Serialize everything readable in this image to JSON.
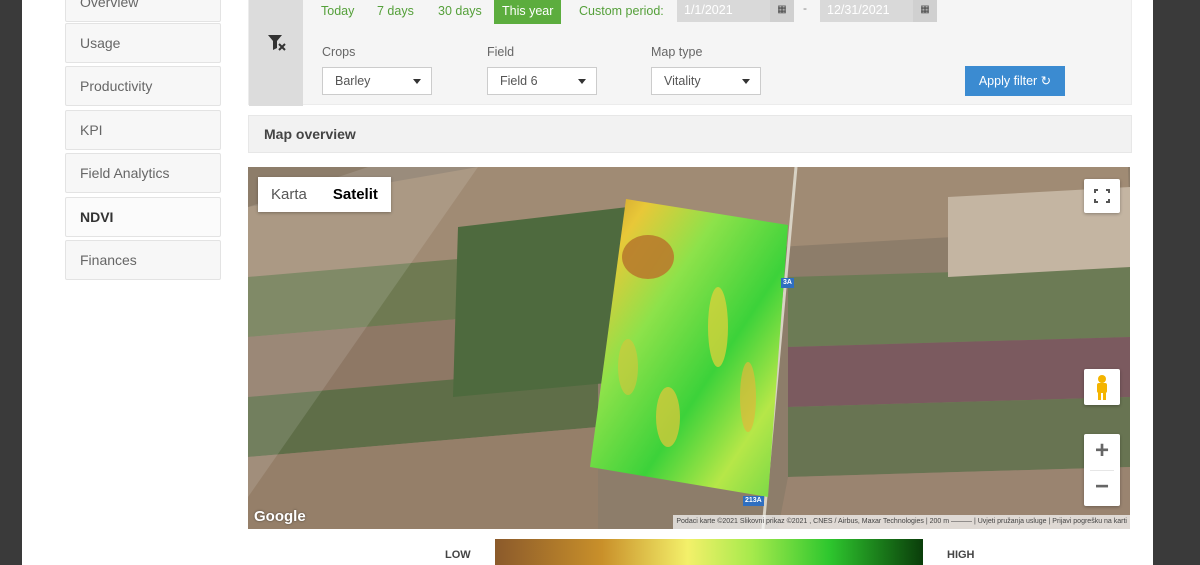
{
  "sidebar": {
    "items": [
      {
        "label": "Overview",
        "active": false
      },
      {
        "label": "Usage",
        "active": false
      },
      {
        "label": "Productivity",
        "active": false
      },
      {
        "label": "KPI",
        "active": false
      },
      {
        "label": "Field Analytics",
        "active": false
      },
      {
        "label": "NDVI",
        "active": true
      },
      {
        "label": "Finances",
        "active": false
      }
    ]
  },
  "filter": {
    "periods": [
      "Today",
      "7 days",
      "30 days",
      "This year"
    ],
    "active_period": "This year",
    "custom_period_label": "Custom period:",
    "date_from": "1/1/2021",
    "date_separator": "-",
    "date_to": "12/31/2021",
    "crops_label": "Crops",
    "crops_value": "Barley",
    "field_label": "Field",
    "field_value": "Field 6",
    "map_type_label": "Map type",
    "map_type_value": "Vitality",
    "apply_label": "Apply filter ↻",
    "filter_icon": "filter-clear-icon",
    "calendar_icon": "calendar-icon"
  },
  "map_panel": {
    "title": "Map overview"
  },
  "map": {
    "type_options": [
      "Karta",
      "Satelit"
    ],
    "selected_type": "Satelit",
    "google_label": "Google",
    "attribution": "Podaci karte ©2021 Slikovni prikaz ©2021 , CNES / Airbus, Maxar Technologies | 200 m ⎯⎯⎯⎯⎯⎯ | Uvjeti pružanja usluge | Prijavi pogrešku na karti",
    "road_label": "213A",
    "road_label_top": "3A",
    "zoom_in": "+",
    "zoom_out": "−",
    "fullscreen_icon": "fullscreen-icon",
    "pegman_icon": "pegman-icon"
  },
  "legend": {
    "low": "LOW",
    "high": "HIGH",
    "colors": [
      "#8b5a2b",
      "#c9902a",
      "#f3f06a",
      "#a6ea4c",
      "#2ec72e",
      "#0a3d0a"
    ]
  }
}
